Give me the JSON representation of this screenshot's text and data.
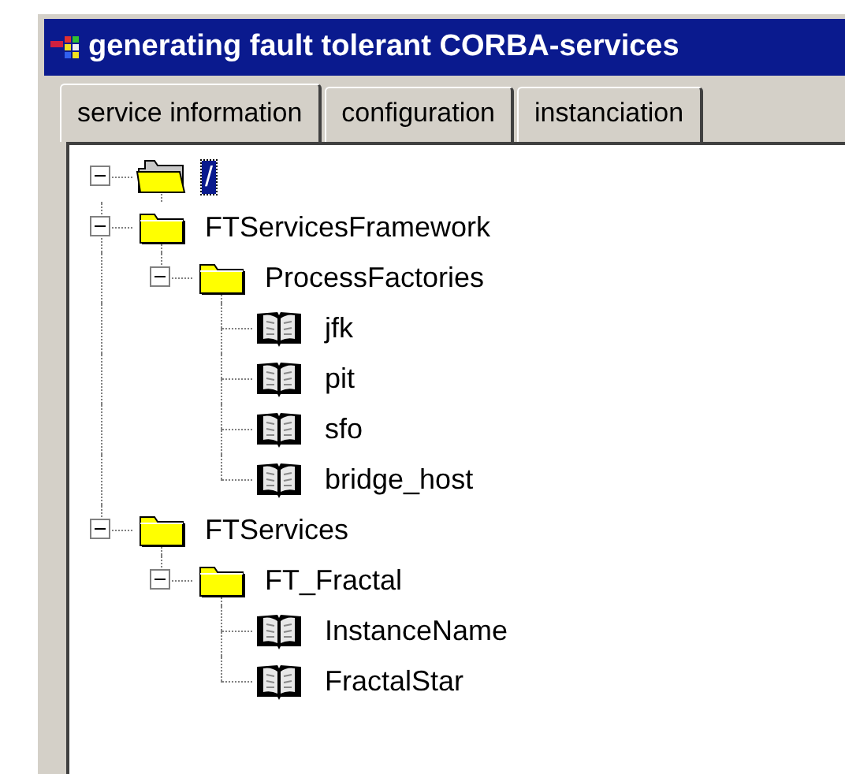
{
  "window": {
    "title": "generating fault tolerant CORBA-services"
  },
  "tabs": [
    {
      "label": "service information",
      "selected": true
    },
    {
      "label": "configuration",
      "selected": false
    },
    {
      "label": "instanciation",
      "selected": false
    }
  ],
  "tree": {
    "nodes": [
      {
        "label": "/",
        "kind": "folder",
        "expanded": true,
        "selected": true,
        "children": [
          {
            "label": "FTServicesFramework",
            "kind": "folder",
            "expanded": true,
            "selected": false,
            "children": [
              {
                "label": "ProcessFactories",
                "kind": "folder",
                "expanded": true,
                "selected": false,
                "children": [
                  {
                    "label": "jfk",
                    "kind": "object",
                    "selected": false
                  },
                  {
                    "label": "pit",
                    "kind": "object",
                    "selected": false
                  },
                  {
                    "label": "sfo",
                    "kind": "object",
                    "selected": false
                  },
                  {
                    "label": "bridge_host",
                    "kind": "object",
                    "selected": false
                  }
                ]
              }
            ]
          },
          {
            "label": "FTServices",
            "kind": "folder",
            "expanded": true,
            "selected": false,
            "children": [
              {
                "label": "FT_Fractal",
                "kind": "folder",
                "expanded": true,
                "selected": false,
                "children": [
                  {
                    "label": "InstanceName",
                    "kind": "object",
                    "selected": false
                  },
                  {
                    "label": "FractalStar",
                    "kind": "object",
                    "selected": false
                  }
                ]
              }
            ]
          }
        ]
      }
    ]
  }
}
